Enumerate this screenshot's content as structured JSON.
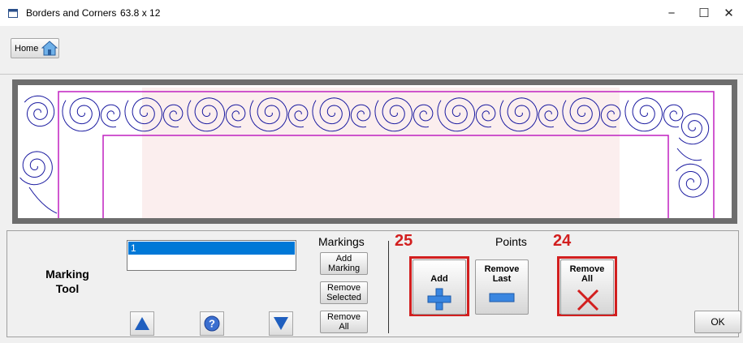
{
  "window": {
    "title": "Borders and Corners",
    "dimensions": "63.8 x 12",
    "minimize_glyph": "−",
    "maximize_glyph": "☐",
    "close_glyph": "✕"
  },
  "toolbar": {
    "home_label": "Home"
  },
  "panel": {
    "marking_tool_label_line1": "Marking",
    "marking_tool_label_line2": "Tool",
    "markings_list": [
      "1",
      ""
    ],
    "markings_heading": "Markings",
    "add_marking_line1": "Add",
    "add_marking_line2": "Marking",
    "remove_selected_line1": "Remove",
    "remove_selected_line2": "Selected",
    "remove_all_line1": "Remove",
    "remove_all_line2": "All",
    "points_heading": "Points",
    "annotation_add": "25",
    "annotation_remove_all": "24",
    "add_point_label": "Add",
    "remove_last_line1": "Remove",
    "remove_last_line2": "Last",
    "remove_all_points_line1": "Remove",
    "remove_all_points_line2": "All",
    "ok_label": "OK",
    "help_glyph": "?"
  },
  "colors": {
    "accent_blue": "#0078d7",
    "annotation_red": "#d21f1f",
    "border_magenta": "#c020c0",
    "design_stroke": "#1a1aa0",
    "quilt_fill": "#fbeeee"
  },
  "icons": [
    "app-icon",
    "home-icon",
    "up-arrow-icon",
    "help-icon",
    "down-arrow-icon",
    "plus-icon",
    "minus-icon",
    "x-icon"
  ]
}
